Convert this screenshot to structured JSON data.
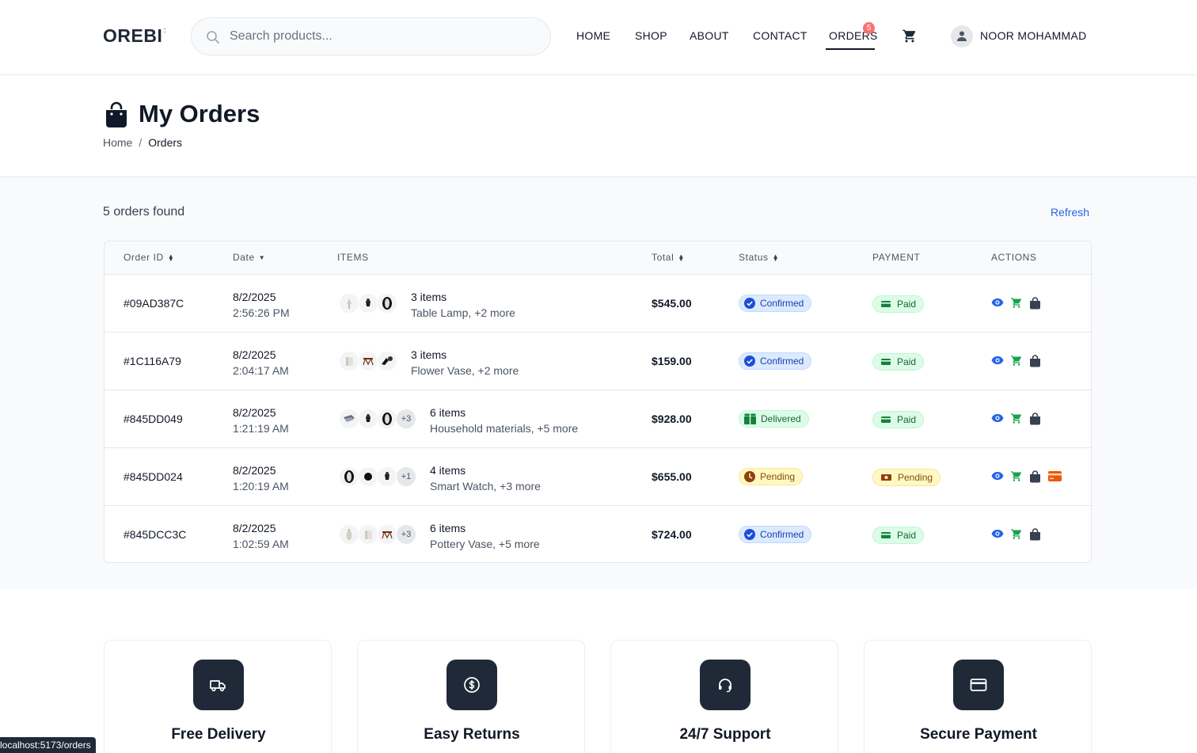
{
  "brand": {
    "logo": "OREBI",
    "logo_dots": "::"
  },
  "search": {
    "placeholder": "Search products..."
  },
  "nav": {
    "items": [
      "HOME",
      "SHOP",
      "ABOUT",
      "CONTACT",
      "ORDERS"
    ],
    "active": "ORDERS",
    "orders_badge": "5",
    "user_name": "NOOR MOHAMMAD"
  },
  "page": {
    "title": "My Orders",
    "breadcrumb": [
      "Home",
      "/",
      "Orders"
    ]
  },
  "summary": {
    "count_text": "5 orders found",
    "refresh_label": "Refresh"
  },
  "table": {
    "headers": [
      "Order ID",
      "Date",
      "ITEMS",
      "Total",
      "Status",
      "PAYMENT",
      "ACTIONS"
    ],
    "rows": [
      {
        "id": "#09AD387C",
        "date": "8/2/2025",
        "time": "2:56:26 PM",
        "more": "",
        "count": "3 items",
        "desc": "Table Lamp, +2 more",
        "total": "$545.00",
        "status": "Confirmed",
        "payment": "Paid"
      },
      {
        "id": "#1C116A79",
        "date": "8/2/2025",
        "time": "2:04:17 AM",
        "more": "",
        "count": "3 items",
        "desc": "Flower Vase, +2 more",
        "total": "$159.00",
        "status": "Confirmed",
        "payment": "Paid"
      },
      {
        "id": "#845DD049",
        "date": "8/2/2025",
        "time": "1:21:19 AM",
        "more": "+3",
        "count": "6 items",
        "desc": "Household materials, +5 more",
        "total": "$928.00",
        "status": "Delivered",
        "payment": "Paid"
      },
      {
        "id": "#845DD024",
        "date": "8/2/2025",
        "time": "1:20:19 AM",
        "more": "+1",
        "count": "4 items",
        "desc": "Smart Watch, +3 more",
        "total": "$655.00",
        "status": "Pending",
        "payment": "Pending"
      },
      {
        "id": "#845DCC3C",
        "date": "8/2/2025",
        "time": "1:02:59 AM",
        "more": "+3",
        "count": "6 items",
        "desc": "Pottery Vase, +5 more",
        "total": "$724.00",
        "status": "Confirmed",
        "payment": "Paid"
      }
    ]
  },
  "features": [
    {
      "title": "Free Delivery",
      "icon": "truck-icon"
    },
    {
      "title": "Easy Returns",
      "icon": "dollar-icon"
    },
    {
      "title": "24/7 Support",
      "icon": "headset-icon"
    },
    {
      "title": "Secure Payment",
      "icon": "credit-card-icon"
    }
  ],
  "statusbar": {
    "url": "localhost:5173/orders"
  },
  "colors": {
    "accent": "#2563eb",
    "dark": "#1f2937",
    "cart_green": "#16a34a",
    "pay_orange": "#ea580c"
  }
}
